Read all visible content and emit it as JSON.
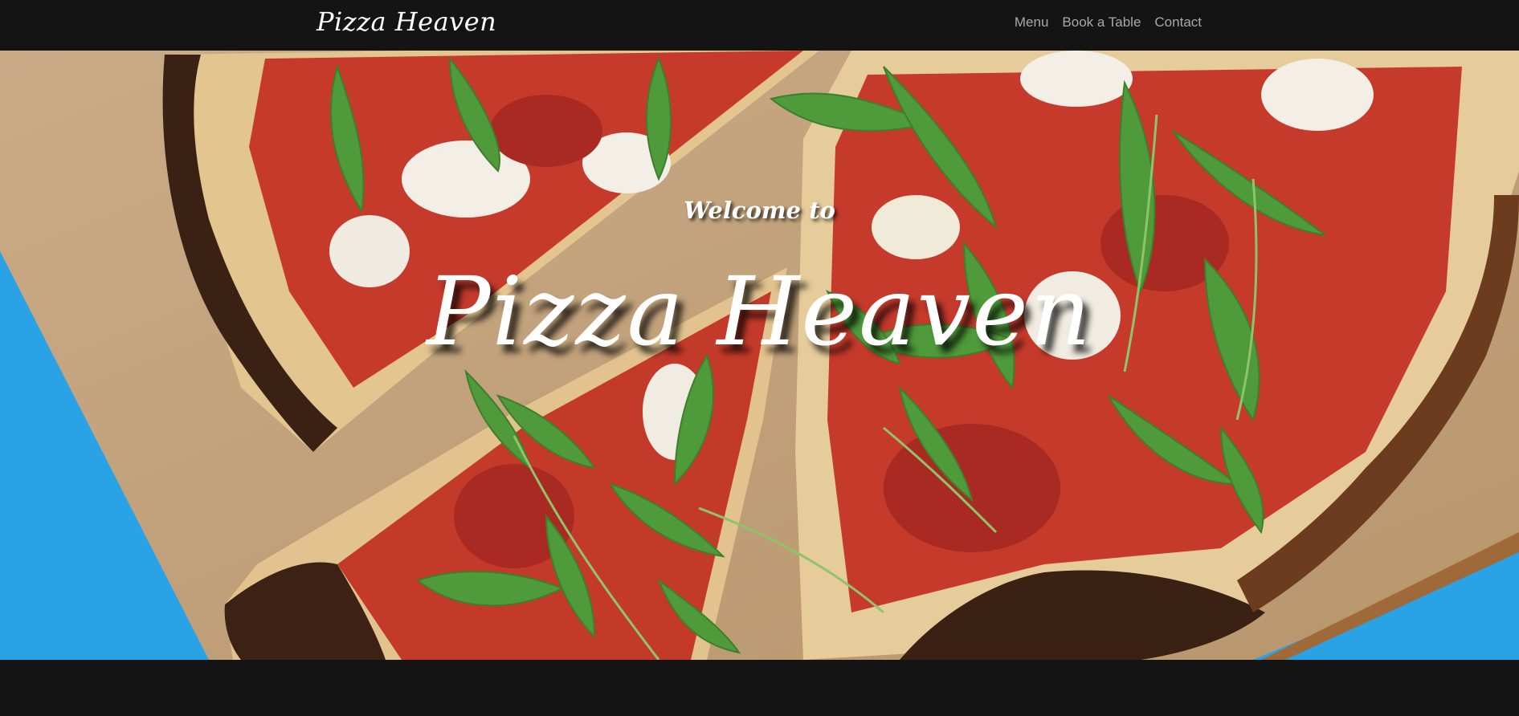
{
  "navbar": {
    "brand": "Pizza Heaven",
    "links": [
      "Menu",
      "Book a Table",
      "Contact"
    ]
  },
  "hero": {
    "welcome": "Welcome to",
    "title": "Pizza Heaven",
    "image": "pizza-photo"
  },
  "colors": {
    "navbar_bg": "#141414",
    "nav_link": "#a8a8a8",
    "brand_text": "#ffffff",
    "table_blue": "#2aa3e6",
    "paper": "#c9a77f",
    "sauce": "#c4332b",
    "arugula": "#4f9a3a"
  }
}
